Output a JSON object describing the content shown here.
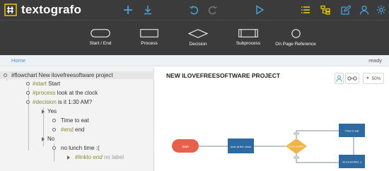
{
  "app": {
    "name": "textografo"
  },
  "toolbar": {
    "icons": [
      "add-icon",
      "download-icon",
      "undo-icon",
      "redo-icon",
      "play-icon",
      "list-icon",
      "hierarchy-icon",
      "edit-icon",
      "user-icon",
      "settings-icon"
    ]
  },
  "shapes": [
    {
      "label": "Start / End"
    },
    {
      "label": "Process"
    },
    {
      "label": "Decision"
    },
    {
      "label": "Subprocess"
    },
    {
      "label": "On Page Reference"
    }
  ],
  "breadcrumb": {
    "home": "Home"
  },
  "status": "ready",
  "editor": {
    "l1": "#flowchart New ilovefreesoftware project",
    "l2_kw": "#start",
    "l2_text": "Start",
    "l3_kw": "#process",
    "l3_text": "look at the clock",
    "l4_kw": "#decision",
    "l4_text": "is it 1:30 AM?",
    "l5": "Yes",
    "l6": "Time to eat",
    "l7_kw": "#end",
    "l7_text": "end",
    "l8": "No",
    "l9": "no lunch time :(",
    "l10_kw": "#linkto",
    "l10_mid": "end",
    "l10_dim": "no label"
  },
  "canvas": {
    "title": "NEW ILOVEFREESOFTWARE PROJECT",
    "zoom": "50%",
    "nodes": {
      "start": "Start",
      "process": "look at the clock",
      "decision": "is it 1:30 AM?",
      "eat": "Time to eat",
      "nolunch": "no lunch time :("
    },
    "colors": {
      "start": "#e8604c",
      "process": "#2d6a9f",
      "decision": "#f0b347"
    }
  }
}
